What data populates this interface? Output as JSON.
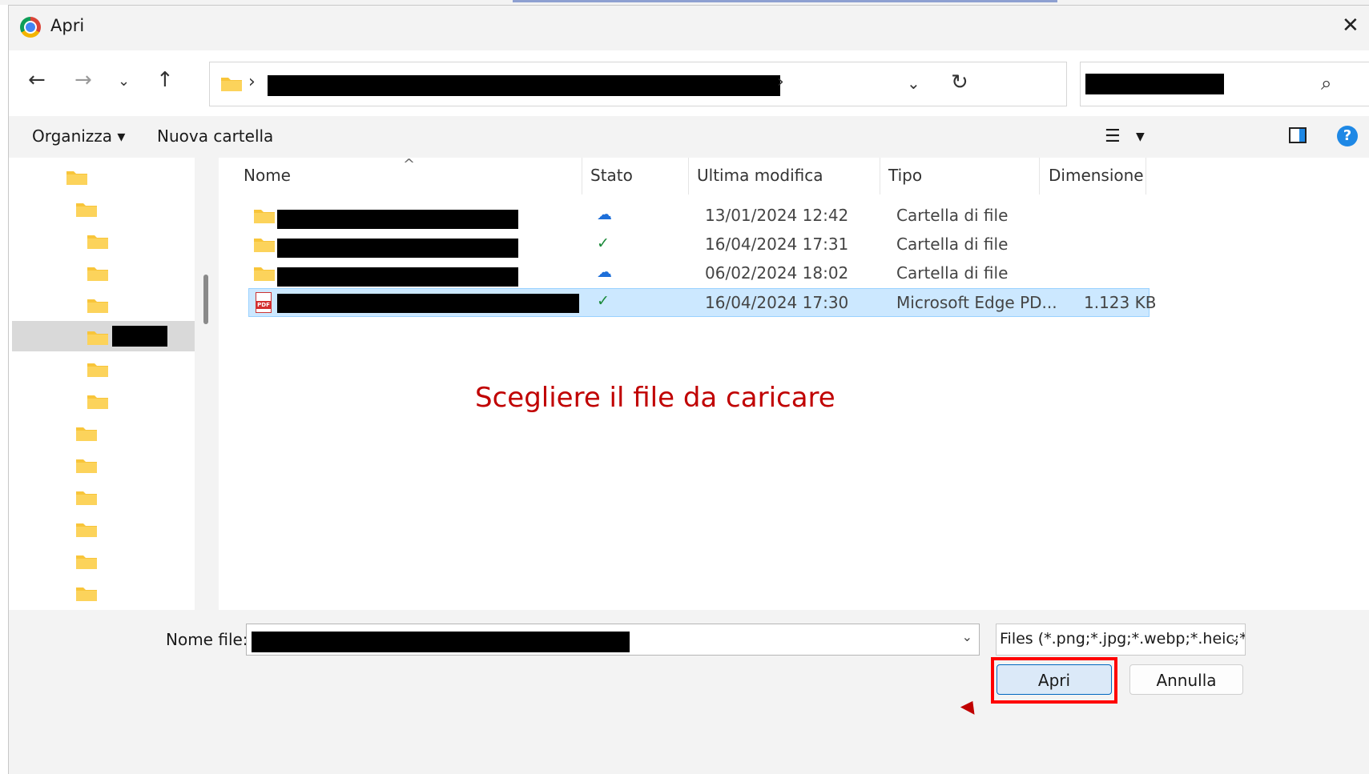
{
  "window": {
    "title": "Apri"
  },
  "nav": {
    "address_separator": "›",
    "address_end_caret": "›"
  },
  "toolbar": {
    "organize": "Organizza ▾",
    "new_folder": "Nuova cartella"
  },
  "columns": {
    "name": "Nome",
    "status": "Stato",
    "modified": "Ultima modifica",
    "type": "Tipo",
    "size": "Dimensione"
  },
  "files": [
    {
      "icon": "folder-icon",
      "status": "cloud",
      "modified": "13/01/2024 12:42",
      "type": "Cartella di file",
      "size": ""
    },
    {
      "icon": "folder-icon",
      "status": "synced",
      "modified": "16/04/2024 17:31",
      "type": "Cartella di file",
      "size": ""
    },
    {
      "icon": "folder-icon",
      "status": "cloud",
      "modified": "06/02/2024 18:02",
      "type": "Cartella di file",
      "size": ""
    },
    {
      "icon": "pdf-icon",
      "status": "synced",
      "modified": "16/04/2024 17:30",
      "type": "Microsoft Edge PD...",
      "size": "1.123 KB",
      "selected": true
    }
  ],
  "annotation": "Scegliere il file da caricare",
  "footer": {
    "filename_label": "Nome file:",
    "filter": "Files (*.png;*.jpg;*.webp;*.heic;*.",
    "open_button": "Apri",
    "cancel_button": "Annulla"
  },
  "colors": {
    "accent": "#0067c0",
    "folder": "#f8c53a",
    "annotation": "#c00000",
    "highlight": "#ff0000",
    "selection": "#cce8ff"
  }
}
